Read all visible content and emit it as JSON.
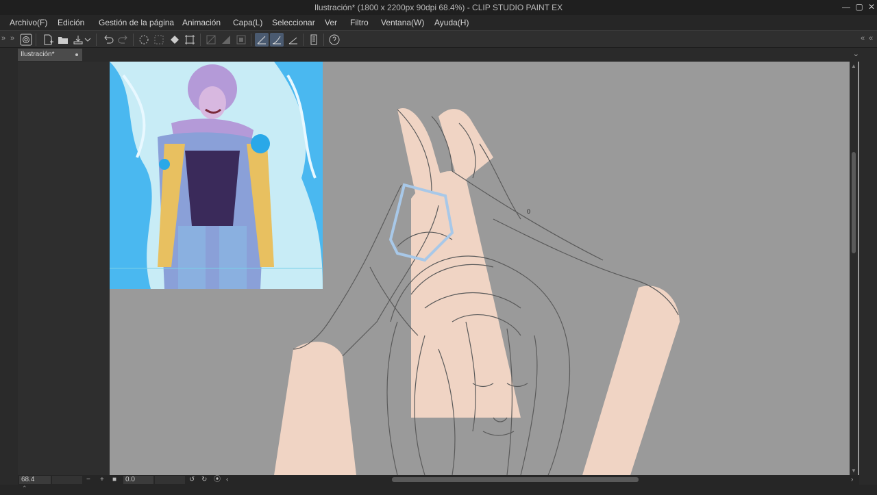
{
  "window": {
    "title": "Ilustración* (1800 x 2200px 90dpi 68.4%)  - CLIP STUDIO PAINT EX",
    "controls": [
      "minimize-icon",
      "maximize-icon",
      "close-icon"
    ]
  },
  "menu": [
    "Archivo(F)",
    "Edición",
    "Gestión de la página",
    "Animación",
    "Capa(L)",
    "Seleccionar",
    "Ver",
    "Filtro",
    "Ventana(W)",
    "Ayuda(H)"
  ],
  "toolbar": {
    "icons": [
      "clip-studio-icon",
      "new-file-icon",
      "open-folder-icon",
      "save-icon",
      "dropdown-icon",
      "undo-icon",
      "redo-icon",
      "loading-icon",
      "deselect-icon",
      "fill-icon",
      "transform-icon",
      "ruler-snap-icon",
      "ruler-snap-2-icon",
      "ruler-snap-3-icon",
      "snap-ruler-icon",
      "snap-special-ruler-icon",
      "snap-grid-icon",
      "ruler-icon",
      "help-icon"
    ]
  },
  "tab": {
    "label": "Ilustración*"
  },
  "canvas": {
    "marker_text": "0",
    "colors": {
      "paper": "#9a9a9a",
      "skin": "#f0d4c4",
      "sketch": "#5a5a5a",
      "glove_outline": "#a8c8e8"
    },
    "reference_image": {
      "subject": "anime-character-reference",
      "palette": [
        "#4ab8f0",
        "#b49ad8",
        "#3a2a5a",
        "#e8c060"
      ]
    }
  },
  "status": {
    "zoom": "68.4",
    "rotation": "0.0"
  }
}
